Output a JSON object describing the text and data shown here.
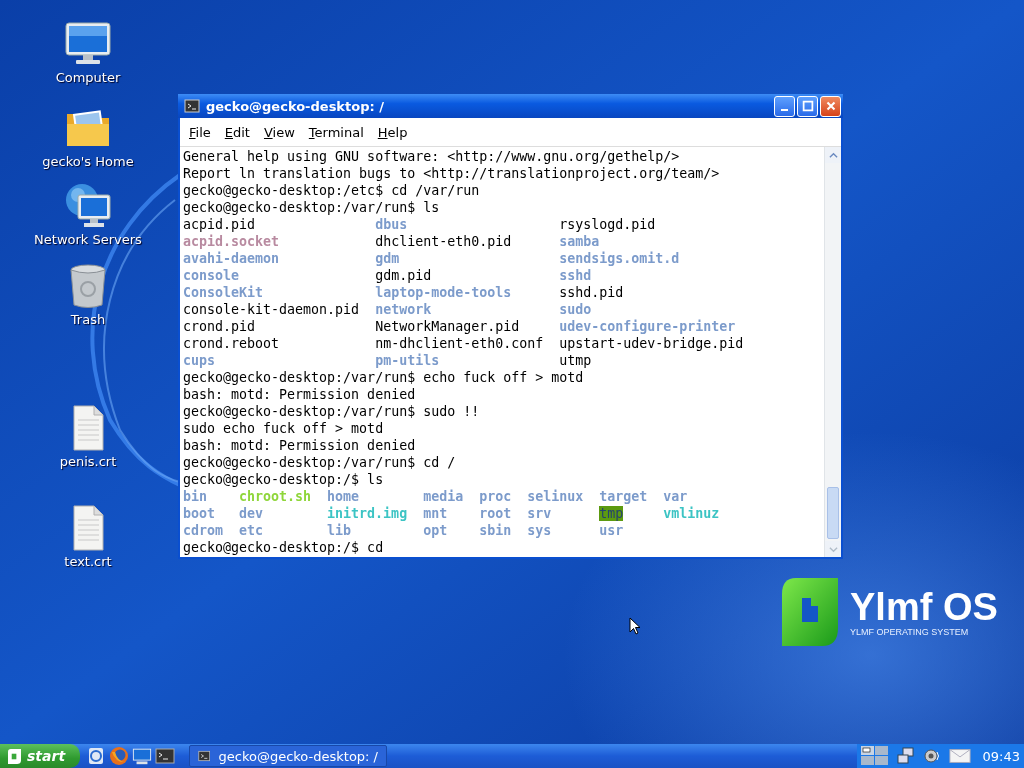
{
  "desktop_icons": [
    {
      "kind": "computer",
      "label": "Computer"
    },
    {
      "kind": "folder",
      "label": "gecko's Home"
    },
    {
      "kind": "network",
      "label": "Network Servers"
    },
    {
      "kind": "trash",
      "label": "Trash"
    },
    {
      "kind": "document",
      "label": "penis.crt"
    },
    {
      "kind": "document",
      "label": "text.crt"
    }
  ],
  "window": {
    "title": "gecko@gecko-desktop: /",
    "menu": [
      {
        "label": "File"
      },
      {
        "label": "Edit"
      },
      {
        "label": "View"
      },
      {
        "label": "Terminal"
      },
      {
        "label": "Help"
      }
    ],
    "lines": [
      {
        "kind": "text",
        "text": "General help using GNU software: <http://www.gnu.org/gethelp/>"
      },
      {
        "kind": "text",
        "text": "Report ln translation bugs to <http://translationproject.org/team/>"
      },
      {
        "kind": "text",
        "text": "gecko@gecko-desktop:/etc$ cd /var/run"
      },
      {
        "kind": "text",
        "text": "gecko@gecko-desktop:/var/run$ ls"
      },
      {
        "kind": "ls",
        "rows": [
          [
            {
              "text": "acpid.pid",
              "kind": "plain"
            },
            {
              "text": "dbus",
              "kind": "dir"
            },
            {
              "text": "rsyslogd.pid",
              "kind": "plain"
            }
          ],
          [
            {
              "text": "acpid.socket",
              "kind": "socket"
            },
            {
              "text": "dhclient-eth0.pid",
              "kind": "plain"
            },
            {
              "text": "samba",
              "kind": "dir"
            }
          ],
          [
            {
              "text": "avahi-daemon",
              "kind": "dir"
            },
            {
              "text": "gdm",
              "kind": "dir"
            },
            {
              "text": "sendsigs.omit.d",
              "kind": "dir"
            }
          ],
          [
            {
              "text": "console",
              "kind": "dir"
            },
            {
              "text": "gdm.pid",
              "kind": "plain"
            },
            {
              "text": "sshd",
              "kind": "dir"
            }
          ],
          [
            {
              "text": "ConsoleKit",
              "kind": "dir"
            },
            {
              "text": "laptop-mode-tools",
              "kind": "dir"
            },
            {
              "text": "sshd.pid",
              "kind": "plain"
            }
          ],
          [
            {
              "text": "console-kit-daemon.pid",
              "kind": "plain"
            },
            {
              "text": "network",
              "kind": "dir"
            },
            {
              "text": "sudo",
              "kind": "dir"
            }
          ],
          [
            {
              "text": "crond.pid",
              "kind": "plain"
            },
            {
              "text": "NetworkManager.pid",
              "kind": "plain"
            },
            {
              "text": "udev-configure-printer",
              "kind": "dir"
            }
          ],
          [
            {
              "text": "crond.reboot",
              "kind": "plain"
            },
            {
              "text": "nm-dhclient-eth0.conf",
              "kind": "plain"
            },
            {
              "text": "upstart-udev-bridge.pid",
              "kind": "plain"
            }
          ],
          [
            {
              "text": "cups",
              "kind": "dir"
            },
            {
              "text": "pm-utils",
              "kind": "dir"
            },
            {
              "text": "utmp",
              "kind": "plain"
            }
          ]
        ]
      },
      {
        "kind": "text",
        "text": "gecko@gecko-desktop:/var/run$ echo fuck off > motd"
      },
      {
        "kind": "text",
        "text": "bash: motd: Permission denied"
      },
      {
        "kind": "text",
        "text": "gecko@gecko-desktop:/var/run$ sudo !!"
      },
      {
        "kind": "text",
        "text": "sudo echo fuck off > motd"
      },
      {
        "kind": "text",
        "text": "bash: motd: Permission denied"
      },
      {
        "kind": "text",
        "text": "gecko@gecko-desktop:/var/run$ cd /"
      },
      {
        "kind": "text",
        "text": "gecko@gecko-desktop:/$ ls"
      },
      {
        "kind": "ls",
        "rows": [
          [
            {
              "text": "bin",
              "kind": "dir"
            },
            {
              "text": "chroot.sh",
              "kind": "exec"
            },
            {
              "text": "home",
              "kind": "dir"
            },
            {
              "text": "media",
              "kind": "dir"
            },
            {
              "text": "proc",
              "kind": "dir"
            },
            {
              "text": "selinux",
              "kind": "dir"
            },
            {
              "text": "target",
              "kind": "dir"
            },
            {
              "text": "var",
              "kind": "dir"
            }
          ],
          [
            {
              "text": "boot",
              "kind": "dir"
            },
            {
              "text": "dev",
              "kind": "dir"
            },
            {
              "text": "initrd.img",
              "kind": "link"
            },
            {
              "text": "mnt",
              "kind": "dir"
            },
            {
              "text": "root",
              "kind": "dir"
            },
            {
              "text": "srv",
              "kind": "dir"
            },
            {
              "text": "tmp",
              "kind": "sticky"
            },
            {
              "text": "vmlinuz",
              "kind": "link"
            }
          ],
          [
            {
              "text": "cdrom",
              "kind": "dir"
            },
            {
              "text": "etc",
              "kind": "dir"
            },
            {
              "text": "lib",
              "kind": "dir"
            },
            {
              "text": "opt",
              "kind": "dir"
            },
            {
              "text": "sbin",
              "kind": "dir"
            },
            {
              "text": "sys",
              "kind": "dir"
            },
            {
              "text": "usr",
              "kind": "dir"
            }
          ]
        ]
      },
      {
        "kind": "text",
        "text": "gecko@gecko-desktop:/$ cd"
      }
    ]
  },
  "logo": {
    "name": "Ylmf OS",
    "tagline": "YLMF OPERATING SYSTEM"
  },
  "taskbar": {
    "start": "start",
    "task": "gecko@gecko-desktop: /",
    "clock": "09:43"
  }
}
